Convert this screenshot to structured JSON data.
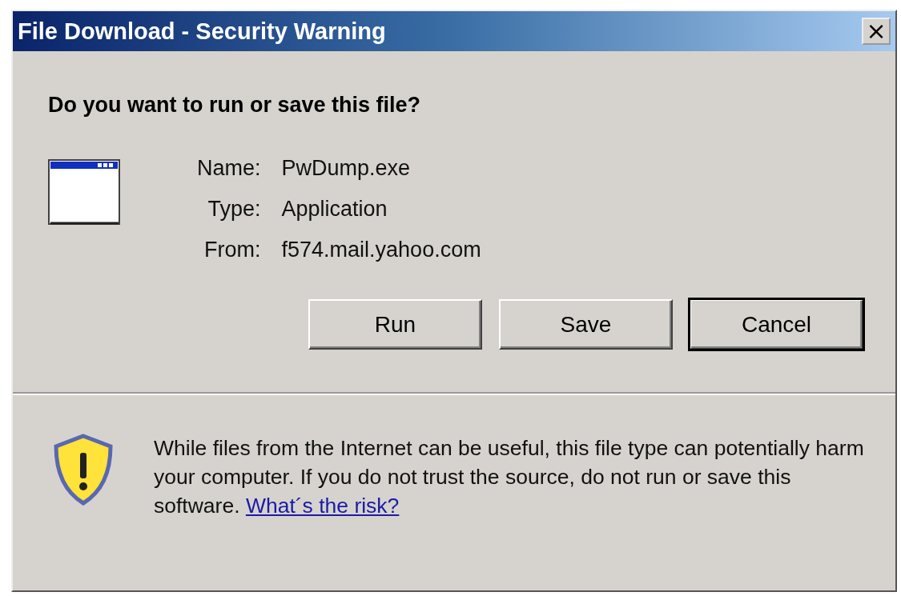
{
  "window": {
    "title": "File Download - Security Warning",
    "close": "×"
  },
  "question": "Do you want to run or save this file?",
  "fields": [
    {
      "label": "Name:",
      "value": "PwDump.exe"
    },
    {
      "label": "Type:",
      "value": "Application"
    },
    {
      "label": "From:",
      "value": "f574.mail.yahoo.com"
    }
  ],
  "buttons": [
    {
      "label": "Run",
      "default": false
    },
    {
      "label": "Save",
      "default": false
    },
    {
      "label": "Cancel",
      "default": true
    }
  ],
  "warning": {
    "text": "While files from the Internet can be useful, this file type can potentially harm your computer. If you do not trust the source, do not run or save this software.",
    "link": "What´s the risk?"
  }
}
